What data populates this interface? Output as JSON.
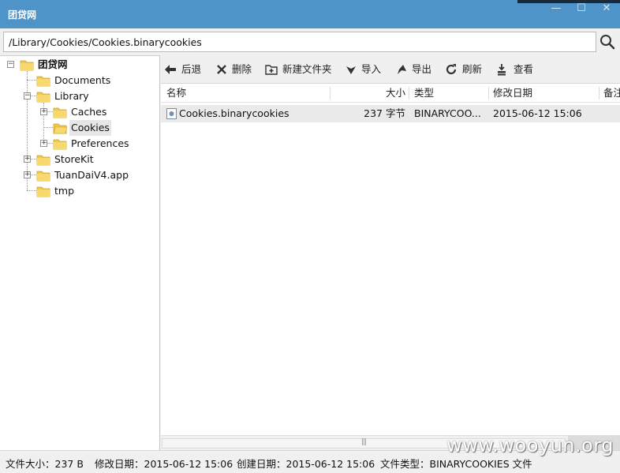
{
  "window": {
    "title": "团贷网",
    "minimize_glyph": "—",
    "maximize_glyph": "☐",
    "close_glyph": "✕"
  },
  "pathbar": {
    "path": "/Library/Cookies/Cookies.binarycookies",
    "search_icon": "search-icon"
  },
  "tree": {
    "root": "团贷网",
    "items": [
      {
        "label": "Documents"
      },
      {
        "label": "Library"
      },
      {
        "label": "Caches"
      },
      {
        "label": "Cookies"
      },
      {
        "label": "Preferences"
      },
      {
        "label": "StoreKit"
      },
      {
        "label": "TuanDaiV4.app"
      },
      {
        "label": "tmp"
      }
    ],
    "selected": "Cookies"
  },
  "toolbar": {
    "back": "后退",
    "delete": "删除",
    "new_folder": "新建文件夹",
    "import": "导入",
    "export": "导出",
    "refresh": "刷新",
    "view": "查看"
  },
  "table": {
    "columns": [
      "名称",
      "大小",
      "类型",
      "修改日期",
      "备注"
    ],
    "rows": [
      {
        "name": "Cookies.binarycookies",
        "size": "237 字节",
        "type": "BINARYCOO...",
        "modified": "2015-06-12 15:06",
        "note": ""
      }
    ],
    "scroll_grip": "|||"
  },
  "status": {
    "file_size": "文件大小：237 B",
    "modified": "修改日期：2015-06-12 15:06",
    "created": "创建日期：2015-06-12 15:06",
    "file_type": "文件类型：BINARYCOOKIES 文件"
  },
  "watermark": "www.wooyun.org",
  "colors": {
    "titlebar": "#4e94c9",
    "folder": "#f2c94c",
    "selection": "#e6e6e6"
  }
}
